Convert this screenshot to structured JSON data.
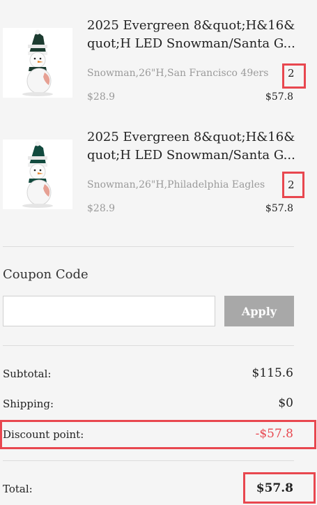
{
  "cart": {
    "items": [
      {
        "title": "2025 Evergreen 8&quot;H&16&\nquot;H LED Snowman/Santa G...",
        "variant": "Snowman,26\"H,San Francisco 49ers",
        "quantity": "2",
        "unit_price": "$28.9",
        "line_total": "$57.8",
        "image_icon": "snowman-figurine-icon"
      },
      {
        "title": "2025 Evergreen 8&quot;H&16&\nquot;H LED Snowman/Santa G...",
        "variant": "Snowman,26\"H,Philadelphia Eagles",
        "quantity": "2",
        "unit_price": "$28.9",
        "line_total": "$57.8",
        "image_icon": "snowman-figurine-icon"
      }
    ]
  },
  "coupon": {
    "heading": "Coupon Code",
    "input_value": "",
    "input_placeholder": "",
    "apply_label": "Apply"
  },
  "summary": {
    "subtotal_label": "Subtotal:",
    "subtotal_value": "$115.6",
    "shipping_label": "Shipping:",
    "shipping_value": "$0",
    "discount_label": "Discount point:",
    "discount_value": "-$57.8",
    "total_label": "Total:",
    "total_value": "$57.8"
  },
  "colors": {
    "highlight": "#e8474f",
    "discount": "#e8474f",
    "apply_button": "#a8a8a8",
    "muted_text": "#9a9a9a",
    "team_green_1": "#1c3b30",
    "team_green_2": "#124a3e"
  }
}
